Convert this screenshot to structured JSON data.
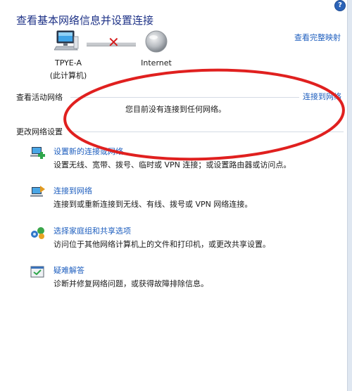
{
  "header": {
    "title": "查看基本网络信息并设置连接",
    "full_map_link": "查看完整映射",
    "help_label": "?"
  },
  "network_map": {
    "computer_name": "TPYE-A",
    "computer_sub": "(此计算机)",
    "internet_label": "Internet",
    "status": "disconnected"
  },
  "active_networks": {
    "header": "查看活动网络",
    "connect_link": "连接到网络",
    "empty_message": "您目前没有连接到任何网络。"
  },
  "change_settings": {
    "header": "更改网络设置",
    "items": [
      {
        "icon": "network-setup-icon",
        "label": "设置新的连接或网络",
        "desc": "设置无线、宽带、拨号、临时或 VPN 连接；或设置路由器或访问点。"
      },
      {
        "icon": "network-connect-icon",
        "label": "连接到网络",
        "desc": "连接到或重新连接到无线、有线、拨号或 VPN 网络连接。"
      },
      {
        "icon": "homegroup-sharing-icon",
        "label": "选择家庭组和共享选项",
        "desc": "访问位于其他网络计算机上的文件和打印机，或更改共享设置。"
      },
      {
        "icon": "troubleshoot-icon",
        "label": "疑难解答",
        "desc": "诊断并修复网络问题，或获得故障排除信息。"
      }
    ]
  },
  "annotation": {
    "color": "#e0201f"
  }
}
